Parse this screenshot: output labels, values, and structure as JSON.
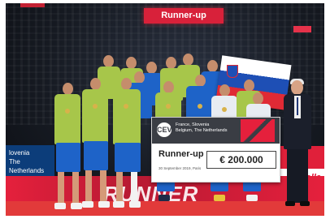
{
  "arena": {
    "top_banner_text": "Runner-up",
    "left_ad_line1": "lovenia",
    "left_ad_line2": "The Netherlands",
    "right_ad_text": "yVolle",
    "floor_text": "RUNNER"
  },
  "cheque": {
    "logo_text": "CEV",
    "teams_line1": "France, Slovenia",
    "teams_line2": "Belgium, The Netherlands",
    "title": "Runner-up",
    "amount": "€ 200.000",
    "date": "30 September 2019, Paris"
  },
  "colors": {
    "jersey": "#a7c64a",
    "shorts": "#1e63c8",
    "banner_red": "#e5203c",
    "cheque_dark": "#3a3d44"
  }
}
